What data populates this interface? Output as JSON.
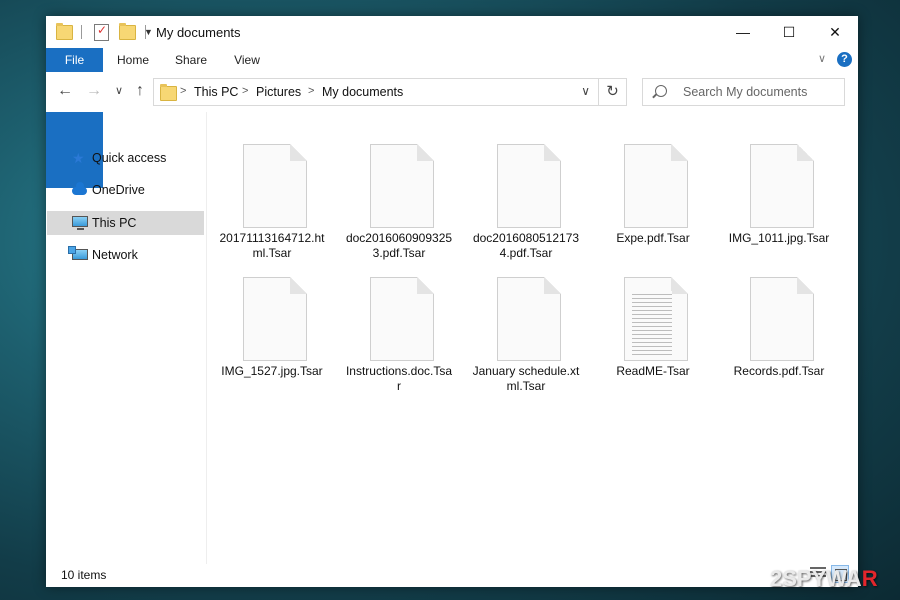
{
  "window": {
    "title": "My documents",
    "controls": {
      "minimize": "—",
      "maximize": "☐",
      "close": "✕"
    }
  },
  "ribbon": {
    "tabs": [
      {
        "label": "File"
      },
      {
        "label": "Home"
      },
      {
        "label": "Share"
      },
      {
        "label": "View"
      }
    ],
    "expand_glyph": "∨",
    "help_glyph": "?"
  },
  "navigation": {
    "back": "←",
    "forward": "→",
    "recent": "∨",
    "up": "↑",
    "breadcrumb": [
      "This PC",
      "Pictures",
      "My documents"
    ],
    "separator": ">",
    "dropdown": "∨",
    "refresh": "↻"
  },
  "search": {
    "placeholder": "Search My documents"
  },
  "sidebar": {
    "items": [
      {
        "label": "Quick access",
        "icon": "star-icon",
        "selected": false
      },
      {
        "label": "OneDrive",
        "icon": "cloud-icon",
        "selected": false
      },
      {
        "label": "This PC",
        "icon": "computer-icon",
        "selected": true
      },
      {
        "label": "Network",
        "icon": "network-icon",
        "selected": false
      }
    ]
  },
  "files": [
    {
      "name": "20171113164712.html.Tsar",
      "icon": "blank-file-icon"
    },
    {
      "name": "doc20160609093253.pdf.Tsar",
      "icon": "blank-file-icon"
    },
    {
      "name": "doc20160805121734.pdf.Tsar",
      "icon": "blank-file-icon"
    },
    {
      "name": "Expe.pdf.Tsar",
      "icon": "blank-file-icon"
    },
    {
      "name": "IMG_1011.jpg.Tsar",
      "icon": "blank-file-icon"
    },
    {
      "name": "IMG_1527.jpg.Tsar",
      "icon": "blank-file-icon"
    },
    {
      "name": "Instructions.doc.Tsar",
      "icon": "blank-file-icon"
    },
    {
      "name": "January schedule.xtml.Tsar",
      "icon": "blank-file-icon"
    },
    {
      "name": "ReadME-Tsar",
      "icon": "text-file-icon"
    },
    {
      "name": "Records.pdf.Tsar",
      "icon": "blank-file-icon"
    }
  ],
  "status": {
    "item_count": "10 items"
  },
  "watermark": {
    "prefix": "2SPYWA",
    "suffix": "R"
  },
  "colors": {
    "accent": "#1a6fc2",
    "selection": "#d9d9d9",
    "folder": "#f7d774"
  }
}
